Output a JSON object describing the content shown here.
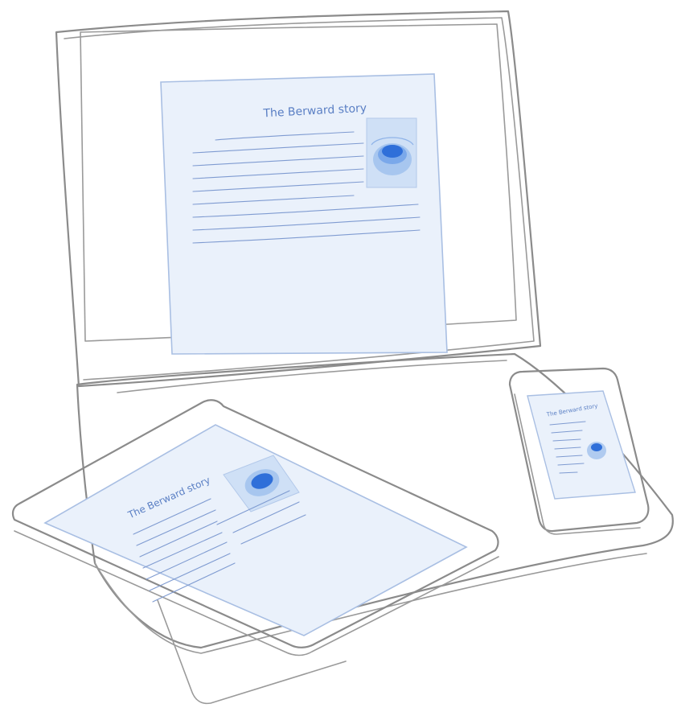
{
  "document": {
    "title": "The Berward story"
  },
  "colors": {
    "outline": "#8b8b8b",
    "screen": "#eaf1fb",
    "screen_border": "#a9bfe3",
    "ink": "#5a7fc4",
    "accent": "#2f6fd9"
  },
  "devices": [
    "laptop",
    "tablet",
    "phone"
  ]
}
